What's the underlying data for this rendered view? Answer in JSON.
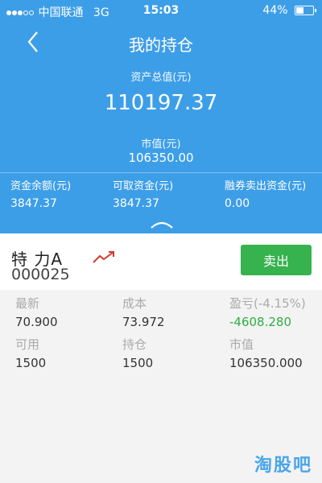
{
  "status_bar": {
    "carrier": "中国联通",
    "network": "3G",
    "time": "15:03",
    "battery": "44%"
  },
  "header": {
    "title": "我的持仓",
    "total_assets_label": "资产总值(元)",
    "total_assets_value": "110197.37",
    "market_value_label": "市值(元)",
    "market_value_value": "106350.00",
    "funds": [
      {
        "label": "资金余额(元)",
        "value": "3847.37"
      },
      {
        "label": "可取资金(元)",
        "value": "3847.37"
      },
      {
        "label": "融券卖出资金(元)",
        "value": "0.00"
      }
    ]
  },
  "stock": {
    "name": "特 力A",
    "code": "000025",
    "sell_label": "卖出",
    "metrics": [
      {
        "label": "最新",
        "value": "70.900"
      },
      {
        "label": "成本",
        "value": "73.972"
      },
      {
        "label": "盈亏(-4.15%)",
        "value": "-4608.280"
      },
      {
        "label": "可用",
        "value": "1500"
      },
      {
        "label": "持仓",
        "value": "1500"
      },
      {
        "label": "市值",
        "value": "106350.000"
      }
    ]
  },
  "colors": {
    "header_bg": "#3d9ee8",
    "sell_button": "#36b24e",
    "loss_text": "#2fae45",
    "trend_icon": "#d23a2e"
  },
  "watermark": "淘股吧"
}
